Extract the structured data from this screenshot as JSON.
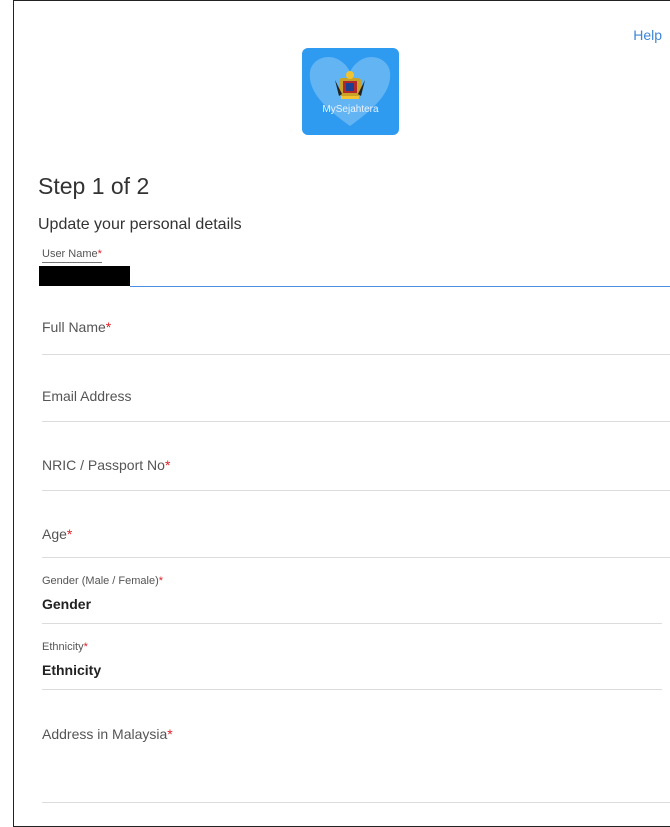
{
  "header": {
    "help_label": "Help"
  },
  "logo": {
    "text": "MySejahtera",
    "icon": "heart-crest-icon"
  },
  "step_title": "Step 1 of 2",
  "subtitle": "Update your personal details",
  "required_marker": "*",
  "fields": {
    "user_name": {
      "label": "User Name",
      "required": true
    },
    "full_name": {
      "label": "Full Name",
      "required": true,
      "value": ""
    },
    "email": {
      "label": "Email Address",
      "required": false,
      "value": ""
    },
    "nric": {
      "label": "NRIC / Passport No",
      "required": true,
      "value": ""
    },
    "age": {
      "label": "Age",
      "required": true,
      "value": ""
    },
    "gender": {
      "label": "Gender (Male / Female)",
      "required": true,
      "value": "Gender"
    },
    "ethnicity": {
      "label": "Ethnicity",
      "required": true,
      "value": "Ethnicity"
    },
    "address": {
      "label": "Address in Malaysia",
      "required": true,
      "value": ""
    }
  },
  "colors": {
    "accent": "#3f86d8",
    "logo_bg": "#2f9bf0",
    "required": "#e0202a"
  }
}
